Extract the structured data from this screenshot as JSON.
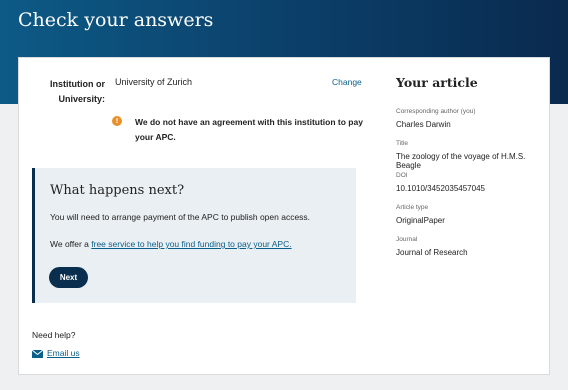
{
  "page": {
    "title": "Check your answers"
  },
  "institution": {
    "label": "Institution or University:",
    "value": "University of Zurich",
    "change_label": "Change"
  },
  "warning": {
    "icon": "warning-icon",
    "icon_glyph": "!",
    "color": "#e8912b",
    "text": "We do not have an agreement with this institution to pay your APC."
  },
  "next": {
    "heading": "What happens next?",
    "line1": "You will need to arrange payment of the APC to publish open access.",
    "line2_prefix": "We offer a ",
    "line2_link": "free service to help you find funding to pay your APC.",
    "button_label": "Next"
  },
  "help": {
    "label": "Need help?",
    "email_icon": "envelope-icon",
    "email_label": "Email us"
  },
  "article": {
    "title": "Your article",
    "fields": [
      {
        "label": "Corresponding author (you)",
        "value": "Charles Darwin"
      },
      {
        "label": "Title",
        "value": "The zoology of the voyage of H.M.S. Beagle"
      },
      {
        "label": "DOI",
        "value": "10.1010/3452035457045"
      },
      {
        "label": "Article type",
        "value": "OriginalPaper"
      },
      {
        "label": "Journal",
        "value": "Journal of Research"
      }
    ]
  },
  "colors": {
    "header_start": "#0d5a86",
    "header_end": "#0a2a4e",
    "link": "#0a5e8a",
    "button": "#0a2f4e",
    "next_box_bg": "#eaeff3"
  }
}
